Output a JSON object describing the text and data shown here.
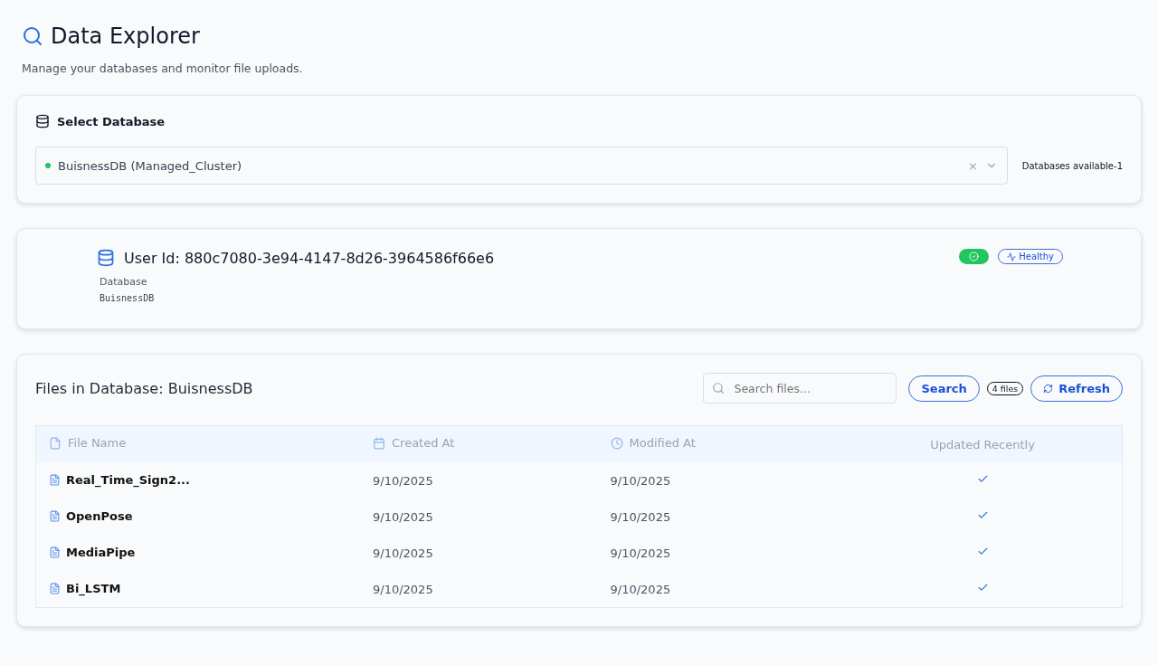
{
  "header": {
    "title": "Data Explorer",
    "subtitle": "Manage your databases and monitor file uploads."
  },
  "select_database": {
    "title": "Select Database",
    "value": "BuisnessDB (Managed_Cluster)",
    "color": "#22c55e",
    "clear": "×",
    "available": "Databases available-1"
  },
  "database_info": {
    "user_id": "User Id: 880c7080-3e94-4147-8d26-3964586f66e6",
    "label": "Database",
    "value": "BuisnessDB",
    "status": "Healthy",
    "connected": true
  },
  "files": {
    "title": "Files in Database: BuisnessDB",
    "search": {
      "placeholder": "Search files..."
    },
    "search_button": "Search",
    "count": "4 files",
    "refresh_button": "Refresh",
    "columns": [
      {
        "label": "File Name",
        "kind": "file"
      },
      {
        "label": "Created At",
        "kind": "calendar"
      },
      {
        "label": "Modified At",
        "kind": "clock"
      },
      {
        "label": "Updated Recently",
        "kind": "none"
      }
    ],
    "rows": [
      {
        "name": "Real_Time_Sign2...",
        "created": "9/10/2025",
        "modified": "9/10/2025",
        "updated_recently": true
      },
      {
        "name": "OpenPose",
        "created": "9/10/2025",
        "modified": "9/10/2025",
        "updated_recently": true
      },
      {
        "name": "MediaPipe",
        "created": "9/10/2025",
        "modified": "9/10/2025",
        "updated_recently": true
      },
      {
        "name": "Bi_LSTM",
        "created": "9/10/2025",
        "modified": "9/10/2025",
        "updated_recently": true
      }
    ]
  }
}
